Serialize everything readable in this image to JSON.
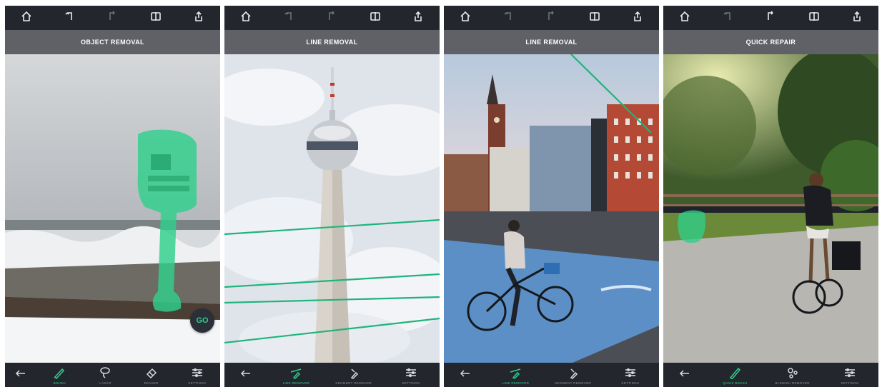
{
  "accent_color": "#2fcf8b",
  "screens": [
    {
      "mode_title": "OBJECT REMOVAL",
      "go_label": "GO",
      "tools": [
        {
          "label": "BRUSH",
          "icon": "brush-icon",
          "active": true
        },
        {
          "label": "LASSO",
          "icon": "lasso-icon",
          "active": false
        },
        {
          "label": "ERASER",
          "icon": "eraser-icon",
          "active": false
        },
        {
          "label": "SETTINGS",
          "icon": "settings-sliders-icon",
          "active": false
        }
      ]
    },
    {
      "mode_title": "LINE REMOVAL",
      "tools": [
        {
          "label": "LINE REMOVER",
          "icon": "line-remover-icon",
          "active": true
        },
        {
          "label": "SEGMENT REMOVER",
          "icon": "segment-remover-icon",
          "active": false
        },
        {
          "label": "SETTINGS",
          "icon": "settings-sliders-icon",
          "active": false
        }
      ]
    },
    {
      "mode_title": "LINE REMOVAL",
      "tools": [
        {
          "label": "LINE REMOVER",
          "icon": "line-remover-icon",
          "active": true
        },
        {
          "label": "SEGMENT REMOVER",
          "icon": "segment-remover-icon",
          "active": false
        },
        {
          "label": "SETTINGS",
          "icon": "settings-sliders-icon",
          "active": false
        }
      ]
    },
    {
      "mode_title": "QUICK REPAIR",
      "tools": [
        {
          "label": "QUICK BRUSH",
          "icon": "quick-brush-icon",
          "active": true
        },
        {
          "label": "BLEMISH REMOVER",
          "icon": "blemish-remover-icon",
          "active": false
        },
        {
          "label": "SETTINGS",
          "icon": "settings-sliders-icon",
          "active": false
        }
      ]
    }
  ]
}
